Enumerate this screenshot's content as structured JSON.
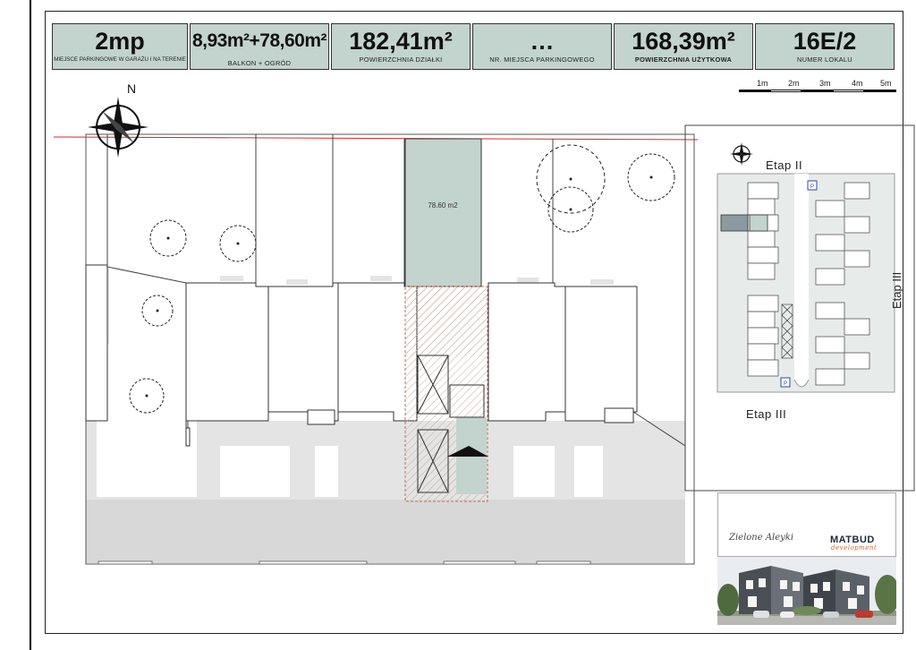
{
  "header": {
    "parking": {
      "value": "2mp",
      "label": "MIEJSCE PARKINGOWE W GARAŻU I NA TERENIE"
    },
    "balcony": {
      "value": "8,93m²+78,60m²",
      "label": "BALKON + OGRÓD"
    },
    "plot": {
      "value": "182,41m²",
      "label": "POWIERZCHNIA DZIAŁKI"
    },
    "spot": {
      "value": "…",
      "label": "NR. MIEJSCA PARKINGOWEGO"
    },
    "usable": {
      "value": "168,39m²",
      "label": "POWIERZCHNIA UŻYTKOWA"
    },
    "unit": {
      "value": "16E/2",
      "label": "NUMER LOKALU"
    }
  },
  "scale": {
    "labels": [
      "1m",
      "2m",
      "3m",
      "4m",
      "5m"
    ]
  },
  "compass": {
    "north": "N"
  },
  "plan": {
    "garden_area": "78.60 m2"
  },
  "inset": {
    "etap2": "Etap II",
    "etap3_right": "Etap III",
    "etap3_bottom": "Etap III",
    "lot_a": "P",
    "lot_b": "P"
  },
  "brand": {
    "left": "Zielone Aleyki",
    "right": "MATBUD",
    "right_sub": "development"
  },
  "colors": {
    "header_bg": "#c2d4cd",
    "garden": "#c2d4cd",
    "red_line": "#d62a2a",
    "road": "#d8d8d8",
    "accent": "#d86a2a"
  }
}
